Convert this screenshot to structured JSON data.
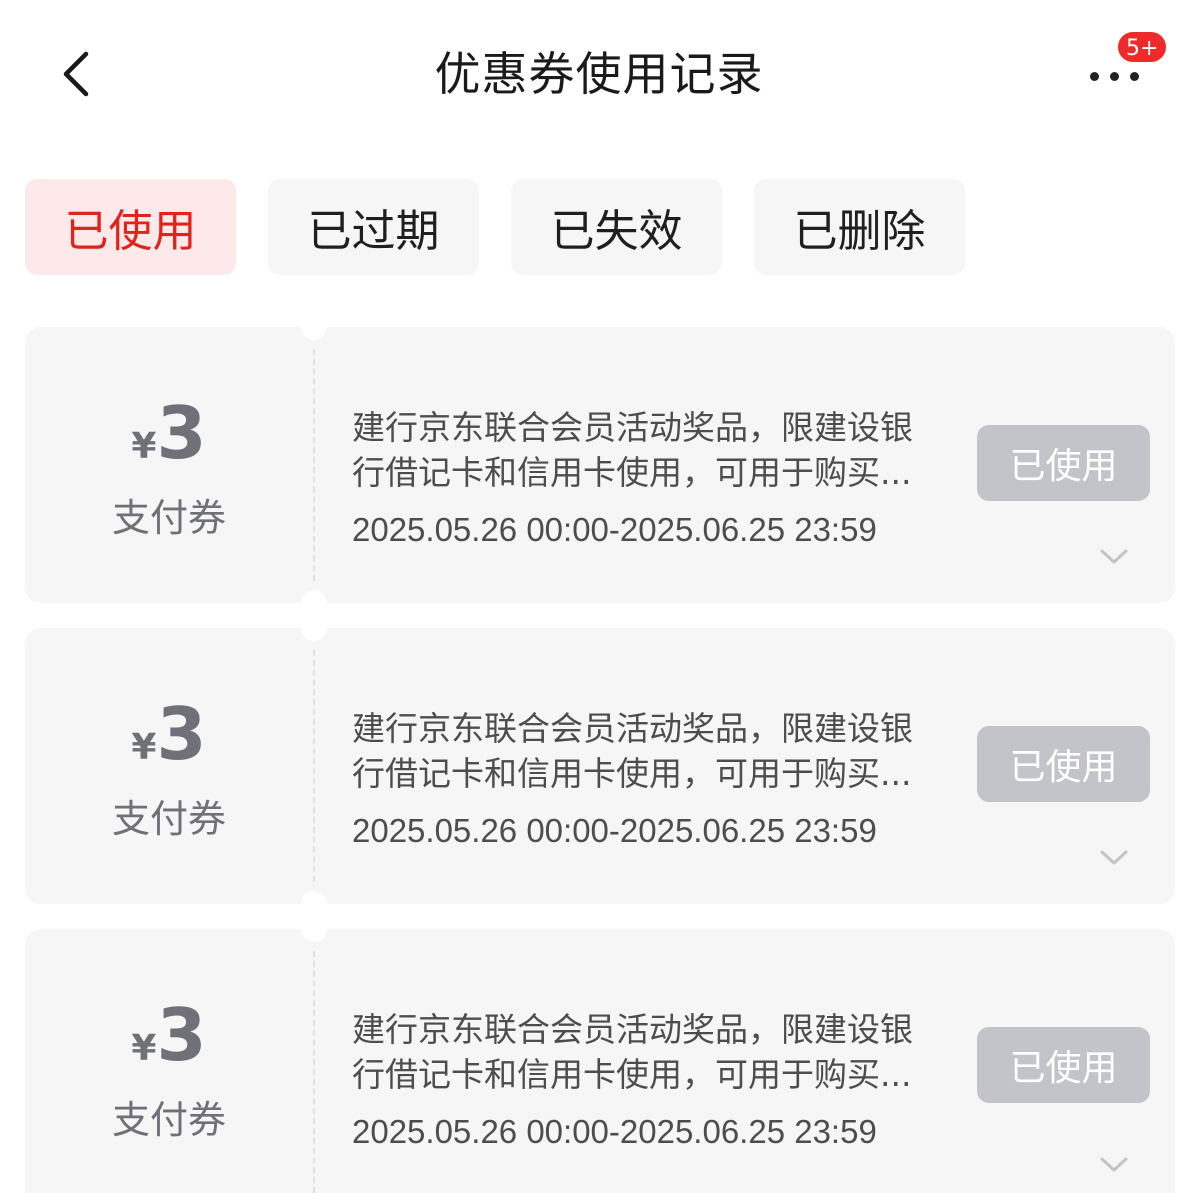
{
  "header": {
    "title": "优惠券使用记录",
    "back_icon": "chevron-left-icon",
    "more_icon": "more-dots-icon",
    "badge": "5+"
  },
  "tabs": [
    {
      "label": "已使用",
      "active": true
    },
    {
      "label": "已过期",
      "active": false
    },
    {
      "label": "已失效",
      "active": false
    },
    {
      "label": "已删除",
      "active": false
    }
  ],
  "colors": {
    "accent": "#e2231a",
    "active_tab_bg": "#fde8ea",
    "badge": "#ef2a2a",
    "used_button": "#c2c4ca",
    "card_bg": "#f6f6f6"
  },
  "coupons": [
    {
      "currency": "¥",
      "amount": "3",
      "type": "支付券",
      "desc_line1": "建行京东联合会员活动奖品，限建设银",
      "desc_line2": "行借记卡和信用卡使用，可用于购买...",
      "validity": "2025.05.26 00:00-2025.06.25 23:59",
      "status": "已使用",
      "expand_icon": "chevron-down-icon"
    },
    {
      "currency": "¥",
      "amount": "3",
      "type": "支付券",
      "desc_line1": "建行京东联合会员活动奖品，限建设银",
      "desc_line2": "行借记卡和信用卡使用，可用于购买...",
      "validity": "2025.05.26 00:00-2025.06.25 23:59",
      "status": "已使用",
      "expand_icon": "chevron-down-icon"
    },
    {
      "currency": "¥",
      "amount": "3",
      "type": "支付券",
      "desc_line1": "建行京东联合会员活动奖品，限建设银",
      "desc_line2": "行借记卡和信用卡使用，可用于购买...",
      "validity": "2025.05.26 00:00-2025.06.25 23:59",
      "status": "已使用",
      "expand_icon": "chevron-down-icon"
    }
  ]
}
